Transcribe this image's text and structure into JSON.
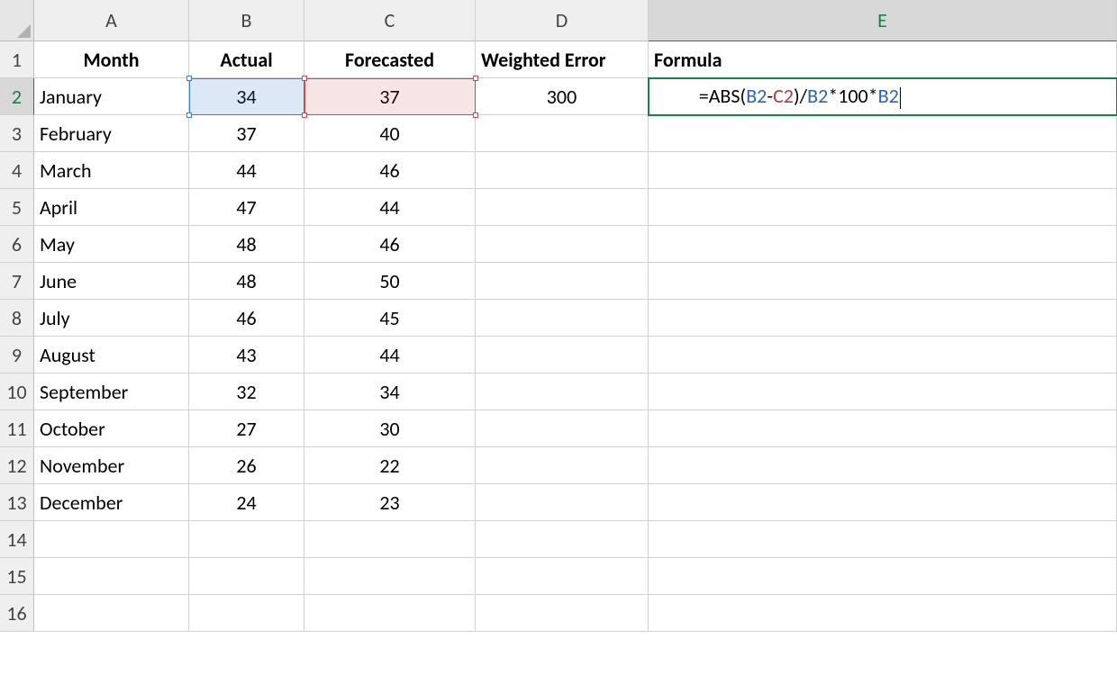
{
  "col_headers": {
    "A": "A",
    "B": "B",
    "C": "C",
    "D": "D",
    "E": "E"
  },
  "row_numbers": [
    "1",
    "2",
    "3",
    "4",
    "5",
    "6",
    "7",
    "8",
    "9",
    "10",
    "11",
    "12",
    "13",
    "14",
    "15",
    "16"
  ],
  "header_row": {
    "A": "Month",
    "B": "Actual",
    "C": "Forecasted",
    "D": "Weighted Error",
    "E": "Formula"
  },
  "rows": [
    {
      "month": "January",
      "actual": "34",
      "forecasted": "37",
      "weighted_error": "300"
    },
    {
      "month": "February",
      "actual": "37",
      "forecasted": "40",
      "weighted_error": ""
    },
    {
      "month": "March",
      "actual": "44",
      "forecasted": "46",
      "weighted_error": ""
    },
    {
      "month": "April",
      "actual": "47",
      "forecasted": "44",
      "weighted_error": ""
    },
    {
      "month": "May",
      "actual": "48",
      "forecasted": "46",
      "weighted_error": ""
    },
    {
      "month": "June",
      "actual": "48",
      "forecasted": "50",
      "weighted_error": ""
    },
    {
      "month": "July",
      "actual": "46",
      "forecasted": "45",
      "weighted_error": ""
    },
    {
      "month": "August",
      "actual": "43",
      "forecasted": "44",
      "weighted_error": ""
    },
    {
      "month": "September",
      "actual": "32",
      "forecasted": "34",
      "weighted_error": ""
    },
    {
      "month": "October",
      "actual": "27",
      "forecasted": "30",
      "weighted_error": ""
    },
    {
      "month": "November",
      "actual": "26",
      "forecasted": "22",
      "weighted_error": ""
    },
    {
      "month": "December",
      "actual": "24",
      "forecasted": "23",
      "weighted_error": ""
    }
  ],
  "formula": {
    "prefix": "=ABS(",
    "ref1": "B2",
    "sep1": "-",
    "ref2": "C2",
    "mid": ")/",
    "ref3": "B2",
    "sep2": "*100*",
    "ref4": "B2"
  },
  "active_cell": "E2"
}
